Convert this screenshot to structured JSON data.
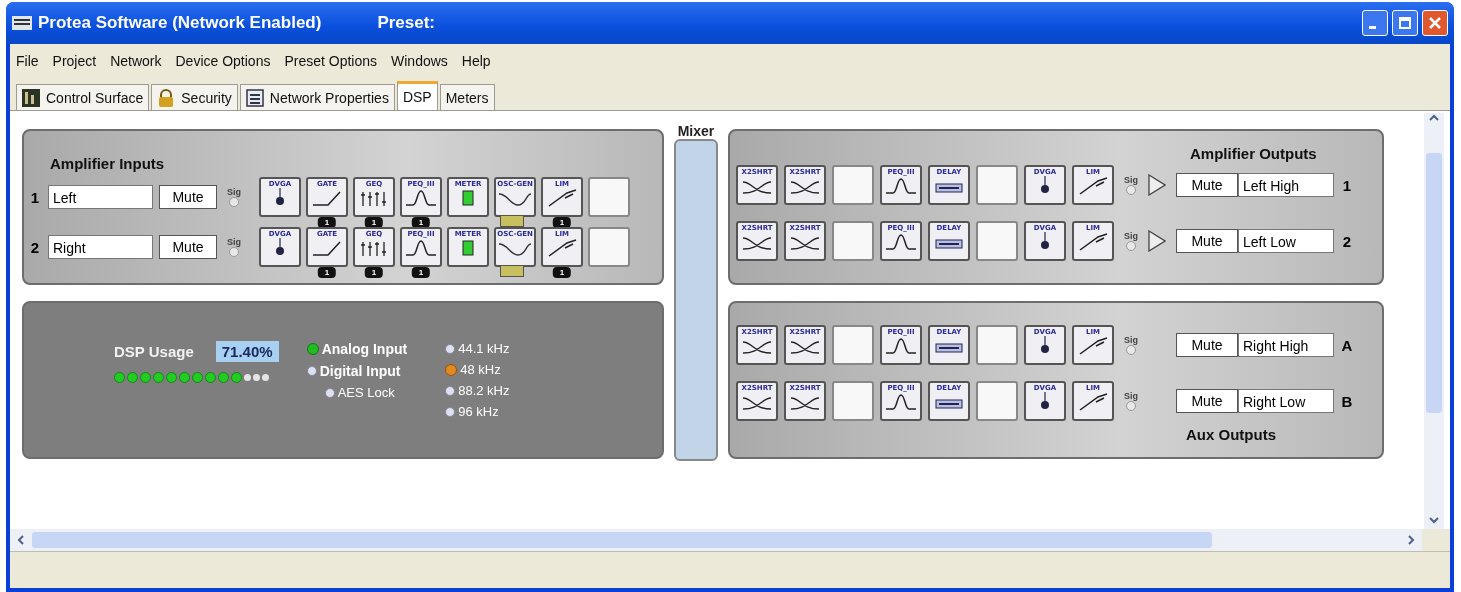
{
  "window": {
    "title": "Protea Software (Network Enabled)",
    "preset_label": "Preset:"
  },
  "menu": [
    "File",
    "Project",
    "Network",
    "Device Options",
    "Preset Options",
    "Windows",
    "Help"
  ],
  "tabs": [
    {
      "label": "Control Surface",
      "selected": false
    },
    {
      "label": "Security",
      "selected": false
    },
    {
      "label": "Network Properties",
      "selected": false
    },
    {
      "label": "DSP",
      "selected": true
    },
    {
      "label": "Meters",
      "selected": false
    }
  ],
  "inputs": {
    "title": "Amplifier Inputs",
    "channels": [
      {
        "number": "1",
        "name": "Left",
        "mute": "Mute",
        "sig": "Sig",
        "blocks": [
          {
            "kind": "dvga",
            "label": "DVGA"
          },
          {
            "kind": "gate",
            "label": "GATE",
            "badge": "1"
          },
          {
            "kind": "geq",
            "label": "GEQ",
            "badge": "1"
          },
          {
            "kind": "peq",
            "label": "PEQ_III",
            "badge": "1"
          },
          {
            "kind": "meter",
            "label": "METER"
          },
          {
            "kind": "osc",
            "label": "OSC-GEN"
          },
          {
            "kind": "lim",
            "label": "LIM",
            "badge": "1"
          },
          {
            "kind": "empty"
          }
        ]
      },
      {
        "number": "2",
        "name": "Right",
        "mute": "Mute",
        "sig": "Sig",
        "blocks": [
          {
            "kind": "dvga",
            "label": "DVGA"
          },
          {
            "kind": "gate",
            "label": "GATE",
            "badge": "1"
          },
          {
            "kind": "geq",
            "label": "GEQ",
            "badge": "1"
          },
          {
            "kind": "peq",
            "label": "PEQ_III",
            "badge": "1"
          },
          {
            "kind": "meter",
            "label": "METER"
          },
          {
            "kind": "osc",
            "label": "OSC-GEN"
          },
          {
            "kind": "lim",
            "label": "LIM",
            "badge": "1"
          },
          {
            "kind": "empty"
          }
        ]
      }
    ]
  },
  "dsp_usage": {
    "label": "DSP Usage",
    "value": "71.40%",
    "level": 0.77,
    "sources": [
      {
        "label": "Analog Input",
        "kind": "radio",
        "selected": true
      },
      {
        "label": "Digital Input",
        "kind": "radio",
        "selected": false
      },
      {
        "label": "AES Lock",
        "kind": "indicator",
        "selected": false
      }
    ],
    "rates": [
      {
        "label": "44.1 kHz",
        "selected": false
      },
      {
        "label": "48 kHz",
        "selected": true
      },
      {
        "label": "88.2 kHz",
        "selected": false
      },
      {
        "label": "96 kHz",
        "selected": false
      }
    ]
  },
  "mixer": {
    "label": "Mixer"
  },
  "outputs": [
    {
      "title": "Amplifier Outputs",
      "channels": [
        {
          "id": "1",
          "name": "Left High",
          "mute": "Mute",
          "sig": "Sig",
          "amp": true,
          "blocks": [
            {
              "kind": "xover",
              "label": "X2SHRT"
            },
            {
              "kind": "xover",
              "label": "X2SHRT"
            },
            {
              "kind": "empty"
            },
            {
              "kind": "peq",
              "label": "PEQ_III"
            },
            {
              "kind": "delay",
              "label": "DELAY"
            },
            {
              "kind": "empty"
            },
            {
              "kind": "dvga",
              "label": "DVGA"
            },
            {
              "kind": "lim",
              "label": "LIM"
            }
          ]
        },
        {
          "id": "2",
          "name": "Left Low",
          "mute": "Mute",
          "sig": "Sig",
          "amp": true,
          "blocks": [
            {
              "kind": "xover",
              "label": "X2SHRT"
            },
            {
              "kind": "xover",
              "label": "X2SHRT"
            },
            {
              "kind": "empty"
            },
            {
              "kind": "peq",
              "label": "PEQ_III"
            },
            {
              "kind": "delay",
              "label": "DELAY"
            },
            {
              "kind": "empty"
            },
            {
              "kind": "dvga",
              "label": "DVGA"
            },
            {
              "kind": "lim",
              "label": "LIM"
            }
          ]
        }
      ]
    },
    {
      "title": "Aux Outputs",
      "channels": [
        {
          "id": "A",
          "name": "Right High",
          "mute": "Mute",
          "sig": "Sig",
          "amp": false,
          "blocks": [
            {
              "kind": "xover",
              "label": "X2SHRT"
            },
            {
              "kind": "xover",
              "label": "X2SHRT"
            },
            {
              "kind": "empty"
            },
            {
              "kind": "peq",
              "label": "PEQ_III"
            },
            {
              "kind": "delay",
              "label": "DELAY"
            },
            {
              "kind": "empty"
            },
            {
              "kind": "dvga",
              "label": "DVGA"
            },
            {
              "kind": "lim",
              "label": "LIM"
            }
          ]
        },
        {
          "id": "B",
          "name": "Right Low",
          "mute": "Mute",
          "sig": "Sig",
          "amp": false,
          "blocks": [
            {
              "kind": "xover",
              "label": "X2SHRT"
            },
            {
              "kind": "xover",
              "label": "X2SHRT"
            },
            {
              "kind": "empty"
            },
            {
              "kind": "peq",
              "label": "PEQ_III"
            },
            {
              "kind": "delay",
              "label": "DELAY"
            },
            {
              "kind": "empty"
            },
            {
              "kind": "dvga",
              "label": "DVGA"
            },
            {
              "kind": "lim",
              "label": "LIM"
            }
          ]
        }
      ]
    }
  ]
}
